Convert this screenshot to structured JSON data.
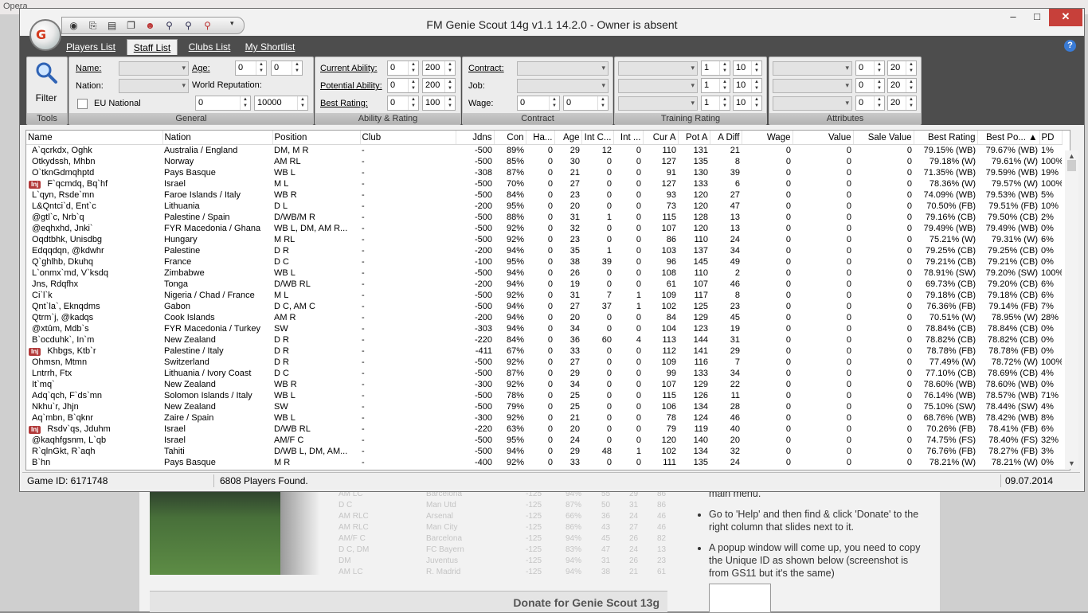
{
  "background": {
    "browser_tab": "Opera",
    "help_menu_text": "main menu.",
    "help_steps": [
      "Go to 'Help' and then find & click 'Donate' to the right column that slides next to it.",
      "A popup window will come up, you need to copy the Unique ID as shown below (screenshot is from GS11 but it's the same)"
    ],
    "donate_banner": "Donate for Genie Scout 13g",
    "ghost_table": [
      [
        "AM LC",
        "Barcelona",
        "-125",
        "94%",
        "55",
        "29",
        "86"
      ],
      [
        "D C",
        "Man Utd",
        "-125",
        "87%",
        "50",
        "31",
        "86"
      ],
      [
        "AM RLC",
        "Arsenal",
        "-125",
        "66%",
        "36",
        "24",
        "46"
      ],
      [
        "AM RLC",
        "Man City",
        "-125",
        "86%",
        "43",
        "27",
        "46"
      ],
      [
        "AM/F C",
        "Barcelona",
        "-125",
        "94%",
        "45",
        "26",
        "82"
      ],
      [
        "D C, DM",
        "FC Bayern",
        "-125",
        "83%",
        "47",
        "24",
        "13"
      ],
      [
        "DM",
        "Juventus",
        "-125",
        "94%",
        "31",
        "26",
        "23"
      ],
      [
        "AM LC",
        "R. Madrid",
        "-125",
        "94%",
        "38",
        "21",
        "61"
      ]
    ]
  },
  "window": {
    "title": "FM Genie Scout 14g v1.1 14.2.0 - Owner is absent",
    "logo_text": "G",
    "min_label": "–",
    "max_label": "□",
    "close_label": "✕",
    "quick_access_arrow": "▾"
  },
  "tabs": [
    {
      "label": "Players List"
    },
    {
      "label": "Staff List"
    },
    {
      "label": "Clubs List"
    },
    {
      "label": "My Shortlist"
    }
  ],
  "help_icon": "?",
  "ribbon": {
    "tools": {
      "filter_label": "Filter",
      "group_label": "Tools"
    },
    "general": {
      "name_label": "Name:",
      "nation_label": "Nation:",
      "eu_label": "EU National",
      "age_label": "Age:",
      "age_min": "0",
      "age_max": "0",
      "world_rep_label": "World Reputation:",
      "rep_min": "0",
      "rep_max": "10000",
      "group_label": "General"
    },
    "ability": {
      "ca_label": "Current Ability:",
      "pa_label": "Potential Ability:",
      "br_label": "Best Rating:",
      "ca_min": "0",
      "ca_max": "200",
      "pa_min": "0",
      "pa_max": "200",
      "br_min": "0",
      "br_max": "100",
      "group_label": "Ability & Rating"
    },
    "contract": {
      "contract_label": "Contract:",
      "job_label": "Job:",
      "wage_label": "Wage:",
      "wage_min": "0",
      "wage_max": "0",
      "group_label": "Contract"
    },
    "training": {
      "rows": [
        {
          "min": "1",
          "max": "10"
        },
        {
          "min": "1",
          "max": "10"
        },
        {
          "min": "1",
          "max": "10"
        }
      ],
      "group_label": "Training  Rating"
    },
    "attributes": {
      "rows": [
        {
          "min": "0",
          "max": "20"
        },
        {
          "min": "0",
          "max": "20"
        },
        {
          "min": "0",
          "max": "20"
        }
      ],
      "group_label": "Attributes"
    }
  },
  "table": {
    "columns": [
      "Name",
      "Nation",
      "Position",
      "Club",
      "Jdns",
      "Con",
      "Ha...",
      "Age",
      "Int C...",
      "Int ...",
      "Cur A",
      "Pot A",
      "A Diff",
      "Wage",
      "Value",
      "Sale Value",
      "Best Rating",
      "Best Po... ▲",
      "PD"
    ],
    "rows": [
      {
        "inj": false,
        "cells": [
          "A`qcrkdx, Oghk",
          "Australia / England",
          "DM, M R",
          "-",
          "-500",
          "89%",
          "0",
          "29",
          "12",
          "0",
          "110",
          "131",
          "21",
          "0",
          "0",
          "0",
          "79.15% (WB)",
          "79.67% (WB)",
          "1%"
        ]
      },
      {
        "inj": false,
        "cells": [
          "Otkydssh, Mhbn",
          "Norway",
          "AM RL",
          "-",
          "-500",
          "85%",
          "0",
          "30",
          "0",
          "0",
          "127",
          "135",
          "8",
          "0",
          "0",
          "0",
          "79.18% (W)",
          "79.61% (W)",
          "100%"
        ]
      },
      {
        "inj": false,
        "cells": [
          "O`tknGdmqhptd",
          "Pays Basque",
          "WB L",
          "-",
          "-308",
          "87%",
          "0",
          "21",
          "0",
          "0",
          "91",
          "130",
          "39",
          "0",
          "0",
          "0",
          "71.35% (WB)",
          "79.59% (WB)",
          "19%"
        ]
      },
      {
        "inj": true,
        "cells": [
          "F`qcmdq, Bq`hf",
          "Israel",
          "M L",
          "-",
          "-500",
          "70%",
          "0",
          "27",
          "0",
          "0",
          "127",
          "133",
          "6",
          "0",
          "0",
          "0",
          "78.36% (W)",
          "79.57% (W)",
          "100%"
        ]
      },
      {
        "inj": false,
        "cells": [
          "L`qyn, Rsde`mn",
          "Faroe Islands / Italy",
          "WB R",
          "-",
          "-500",
          "84%",
          "0",
          "23",
          "0",
          "0",
          "93",
          "120",
          "27",
          "0",
          "0",
          "0",
          "74.09% (WB)",
          "79.53% (WB)",
          "5%"
        ]
      },
      {
        "inj": false,
        "cells": [
          "L&Qntci`d, Ent`c",
          "Lithuania",
          "D L",
          "-",
          "-200",
          "95%",
          "0",
          "20",
          "0",
          "0",
          "73",
          "120",
          "47",
          "0",
          "0",
          "0",
          "70.50% (FB)",
          "79.51% (FB)",
          "10%"
        ]
      },
      {
        "inj": false,
        "cells": [
          "@gtl`c, Nrb`q",
          "Palestine / Spain",
          "D/WB/M R",
          "-",
          "-500",
          "88%",
          "0",
          "31",
          "1",
          "0",
          "115",
          "128",
          "13",
          "0",
          "0",
          "0",
          "79.16% (CB)",
          "79.50% (CB)",
          "2%"
        ]
      },
      {
        "inj": false,
        "cells": [
          "@eqhxhd, Jnki`",
          "FYR Macedonia / Ghana",
          "WB L, DM, AM R...",
          "-",
          "-500",
          "92%",
          "0",
          "32",
          "0",
          "0",
          "107",
          "120",
          "13",
          "0",
          "0",
          "0",
          "79.49% (WB)",
          "79.49% (WB)",
          "0%"
        ]
      },
      {
        "inj": false,
        "cells": [
          "Oqdtbhk, Unisdbg",
          "Hungary",
          "M RL",
          "-",
          "-500",
          "92%",
          "0",
          "23",
          "0",
          "0",
          "86",
          "110",
          "24",
          "0",
          "0",
          "0",
          "75.21% (W)",
          "79.31% (W)",
          "6%"
        ]
      },
      {
        "inj": false,
        "cells": [
          "Edqqdqn, @kdwhr",
          "Palestine",
          "D R",
          "-",
          "-200",
          "94%",
          "0",
          "35",
          "1",
          "0",
          "103",
          "137",
          "34",
          "0",
          "0",
          "0",
          "79.25% (CB)",
          "79.25% (CB)",
          "0%"
        ]
      },
      {
        "inj": false,
        "cells": [
          "Q`ghlhb, Dkuhq",
          "France",
          "D C",
          "-",
          "-100",
          "95%",
          "0",
          "38",
          "39",
          "0",
          "96",
          "145",
          "49",
          "0",
          "0",
          "0",
          "79.21% (CB)",
          "79.21% (CB)",
          "0%"
        ]
      },
      {
        "inj": false,
        "cells": [
          "L`onmx`md, V`ksdq",
          "Zimbabwe",
          "WB L",
          "-",
          "-500",
          "94%",
          "0",
          "26",
          "0",
          "0",
          "108",
          "110",
          "2",
          "0",
          "0",
          "0",
          "78.91% (SW)",
          "79.20% (SW)",
          "100%"
        ]
      },
      {
        "inj": false,
        "cells": [
          "Jns, Rdqfhx",
          "Tonga",
          "D/WB RL",
          "-",
          "-200",
          "94%",
          "0",
          "19",
          "0",
          "0",
          "61",
          "107",
          "46",
          "0",
          "0",
          "0",
          "69.73% (CB)",
          "79.20% (CB)",
          "6%"
        ]
      },
      {
        "inj": false,
        "cells": [
          "Ci`l`k",
          "Nigeria / Chad / France",
          "M L",
          "-",
          "-500",
          "92%",
          "0",
          "31",
          "7",
          "1",
          "109",
          "117",
          "8",
          "0",
          "0",
          "0",
          "79.18% (CB)",
          "79.18% (CB)",
          "6%"
        ]
      },
      {
        "inj": false,
        "cells": [
          "Qnt`la`, Eknqdms",
          "Gabon",
          "D C, AM C",
          "-",
          "-500",
          "94%",
          "0",
          "27",
          "37",
          "1",
          "102",
          "125",
          "23",
          "0",
          "0",
          "0",
          "76.36% (FB)",
          "79.14% (FB)",
          "7%"
        ]
      },
      {
        "inj": false,
        "cells": [
          "Qtrm`j, @kadqs",
          "Cook Islands",
          "AM R",
          "-",
          "-200",
          "94%",
          "0",
          "20",
          "0",
          "0",
          "84",
          "129",
          "45",
          "0",
          "0",
          "0",
          "70.51% (W)",
          "78.95% (W)",
          "28%"
        ]
      },
      {
        "inj": false,
        "cells": [
          "@xtûm, Mdb`s",
          "FYR Macedonia / Turkey",
          "SW",
          "-",
          "-303",
          "94%",
          "0",
          "34",
          "0",
          "0",
          "104",
          "123",
          "19",
          "0",
          "0",
          "0",
          "78.84% (CB)",
          "78.84% (CB)",
          "0%"
        ]
      },
      {
        "inj": false,
        "cells": [
          "B`ocduhk`, In`m",
          "New Zealand",
          "D R",
          "-",
          "-220",
          "84%",
          "0",
          "36",
          "60",
          "4",
          "113",
          "144",
          "31",
          "0",
          "0",
          "0",
          "78.82% (CB)",
          "78.82% (CB)",
          "0%"
        ]
      },
      {
        "inj": true,
        "cells": [
          "Khbgs, Ktb`r",
          "Palestine / Italy",
          "D R",
          "-",
          "-411",
          "67%",
          "0",
          "33",
          "0",
          "0",
          "112",
          "141",
          "29",
          "0",
          "0",
          "0",
          "78.78% (FB)",
          "78.78% (FB)",
          "0%"
        ]
      },
      {
        "inj": false,
        "cells": [
          "Ohmsn, Mtmn",
          "Switzerland",
          "D R",
          "-",
          "-500",
          "92%",
          "0",
          "27",
          "0",
          "0",
          "109",
          "116",
          "7",
          "0",
          "0",
          "0",
          "77.49% (W)",
          "78.72% (W)",
          "100%"
        ]
      },
      {
        "inj": false,
        "cells": [
          "Lntrrh, Ftx",
          "Lithuania / Ivory Coast",
          "D C",
          "-",
          "-500",
          "87%",
          "0",
          "29",
          "0",
          "0",
          "99",
          "133",
          "34",
          "0",
          "0",
          "0",
          "77.10% (CB)",
          "78.69% (CB)",
          "4%"
        ]
      },
      {
        "inj": false,
        "cells": [
          "It`mq`",
          "New Zealand",
          "WB R",
          "-",
          "-300",
          "92%",
          "0",
          "34",
          "0",
          "0",
          "107",
          "129",
          "22",
          "0",
          "0",
          "0",
          "78.60% (WB)",
          "78.60% (WB)",
          "0%"
        ]
      },
      {
        "inj": false,
        "cells": [
          "Adq`qch, F`ds`mn",
          "Solomon Islands / Italy",
          "WB L",
          "-",
          "-500",
          "78%",
          "0",
          "25",
          "0",
          "0",
          "115",
          "126",
          "11",
          "0",
          "0",
          "0",
          "76.14% (WB)",
          "78.57% (WB)",
          "71%"
        ]
      },
      {
        "inj": false,
        "cells": [
          "Nkhu`r, Jhjn",
          "New Zealand",
          "SW",
          "-",
          "-500",
          "79%",
          "0",
          "25",
          "0",
          "0",
          "106",
          "134",
          "28",
          "0",
          "0",
          "0",
          "75.10% (SW)",
          "78.44% (SW)",
          "4%"
        ]
      },
      {
        "inj": false,
        "cells": [
          "Aq`mbn, B`qknr",
          "Zaire / Spain",
          "WB L",
          "-",
          "-300",
          "92%",
          "0",
          "21",
          "0",
          "0",
          "78",
          "124",
          "46",
          "0",
          "0",
          "0",
          "68.76% (WB)",
          "78.42% (WB)",
          "8%"
        ]
      },
      {
        "inj": true,
        "cells": [
          "Rsdv`qs, Jduhm",
          "Israel",
          "D/WB RL",
          "-",
          "-220",
          "63%",
          "0",
          "20",
          "0",
          "0",
          "79",
          "119",
          "40",
          "0",
          "0",
          "0",
          "70.26% (FB)",
          "78.41% (FB)",
          "6%"
        ]
      },
      {
        "inj": false,
        "cells": [
          "@kaqhfgsnm, L`qb",
          "Israel",
          "AM/F C",
          "-",
          "-500",
          "95%",
          "0",
          "24",
          "0",
          "0",
          "120",
          "140",
          "20",
          "0",
          "0",
          "0",
          "74.75% (FS)",
          "78.40% (FS)",
          "32%"
        ]
      },
      {
        "inj": false,
        "cells": [
          "R`qlnGkt, R`aqh",
          "Tahiti",
          "D/WB L, DM, AM...",
          "-",
          "-500",
          "94%",
          "0",
          "29",
          "48",
          "1",
          "102",
          "134",
          "32",
          "0",
          "0",
          "0",
          "76.76% (FB)",
          "78.27% (FB)",
          "3%"
        ]
      },
      {
        "inj": false,
        "cells": [
          "B`hn",
          "Pays Basque",
          "M R",
          "-",
          "-400",
          "92%",
          "0",
          "33",
          "0",
          "0",
          "111",
          "135",
          "24",
          "0",
          "0",
          "0",
          "78.21% (W)",
          "78.21% (W)",
          "0%"
        ]
      }
    ]
  },
  "status": {
    "game_id": "Game ID: 6171748",
    "found": "6808 Players Found.",
    "date": "09.07.2014"
  },
  "icons": {
    "quick_access": [
      "open-icon",
      "export-icon",
      "save-icon",
      "copy-icon",
      "delete-player-icon",
      "search-player-icon",
      "zoom-icon",
      "remove-icon"
    ],
    "filter": "magnifier-icon"
  }
}
